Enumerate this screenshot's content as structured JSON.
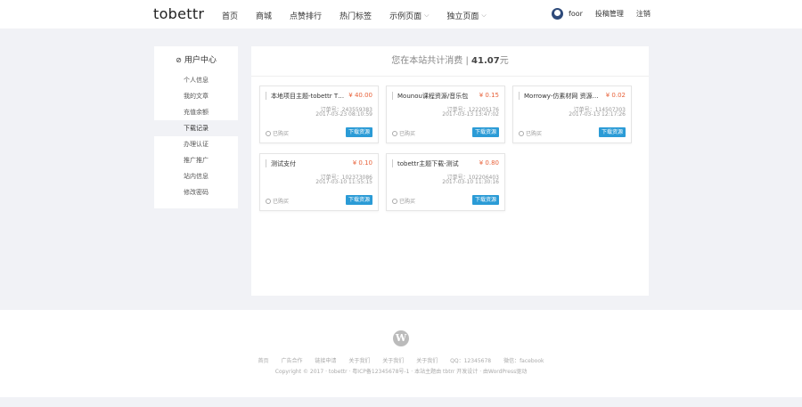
{
  "header": {
    "logo": "tobettr",
    "nav": [
      {
        "label": "首页",
        "has_dropdown": false
      },
      {
        "label": "商城",
        "has_dropdown": false
      },
      {
        "label": "点赞排行",
        "has_dropdown": false
      },
      {
        "label": "热门标签",
        "has_dropdown": false
      },
      {
        "label": "示例页面",
        "has_dropdown": true
      },
      {
        "label": "独立页面",
        "has_dropdown": true
      }
    ],
    "user": {
      "name": "foor",
      "link1": "投稿管理",
      "link2": "注销"
    }
  },
  "sidebar": {
    "title": "用户中心",
    "items": [
      {
        "label": "个人信息",
        "active": false
      },
      {
        "label": "我的文章",
        "active": false
      },
      {
        "label": "充值余额",
        "active": false
      },
      {
        "label": "下载记录",
        "active": true
      },
      {
        "label": "办理认证",
        "active": false
      },
      {
        "label": "推广推广",
        "active": false
      },
      {
        "label": "站内信息",
        "active": false
      },
      {
        "label": "修改密码",
        "active": false
      }
    ]
  },
  "main": {
    "header_prefix": "您在本站共计消费 |",
    "total": "41.07",
    "unit": "元",
    "orders": [
      {
        "title": "本地项目主题-tobettr Theme",
        "price": "¥ 40.00",
        "order_no": "订单号：243559383",
        "date": "2017-03-23 08:10:59",
        "status": "已购买",
        "button": "下载资源"
      },
      {
        "title": "Mounou课程资源/音乐包",
        "price": "¥ 0.15",
        "order_no": "订单号：122205176",
        "date": "2017-03-13 13:47:02",
        "status": "已购买",
        "button": "下载资源"
      },
      {
        "title": "Morrowy-仿素材网 资源 W",
        "price": "¥ 0.02",
        "order_no": "订单号：114507303",
        "date": "2017-03-13 12:17:26",
        "status": "已购买",
        "button": "下载资源"
      },
      {
        "title": "测试支付",
        "price": "¥ 0.10",
        "order_no": "订单号：102373086",
        "date": "2017-03-10 11:55:15",
        "status": "已购买",
        "button": "下载资源"
      },
      {
        "title": "tobettr主题下载-测试",
        "price": "¥ 0.80",
        "order_no": "订单号：102206403",
        "date": "2017-03-10 11:30:16",
        "status": "已购买",
        "button": "下载资源"
      }
    ]
  },
  "footer": {
    "links": [
      "首页",
      "广告合作",
      "链接申请",
      "关于我们",
      "关于我们",
      "关于我们",
      "QQ：12345678",
      "微信：facebook"
    ],
    "copyright": "Copyright © 2017 · tobettr · 粤ICP备12345678号-1 · 本站主题由 tbtrr 开发设计 · 由WordPress驱动"
  }
}
